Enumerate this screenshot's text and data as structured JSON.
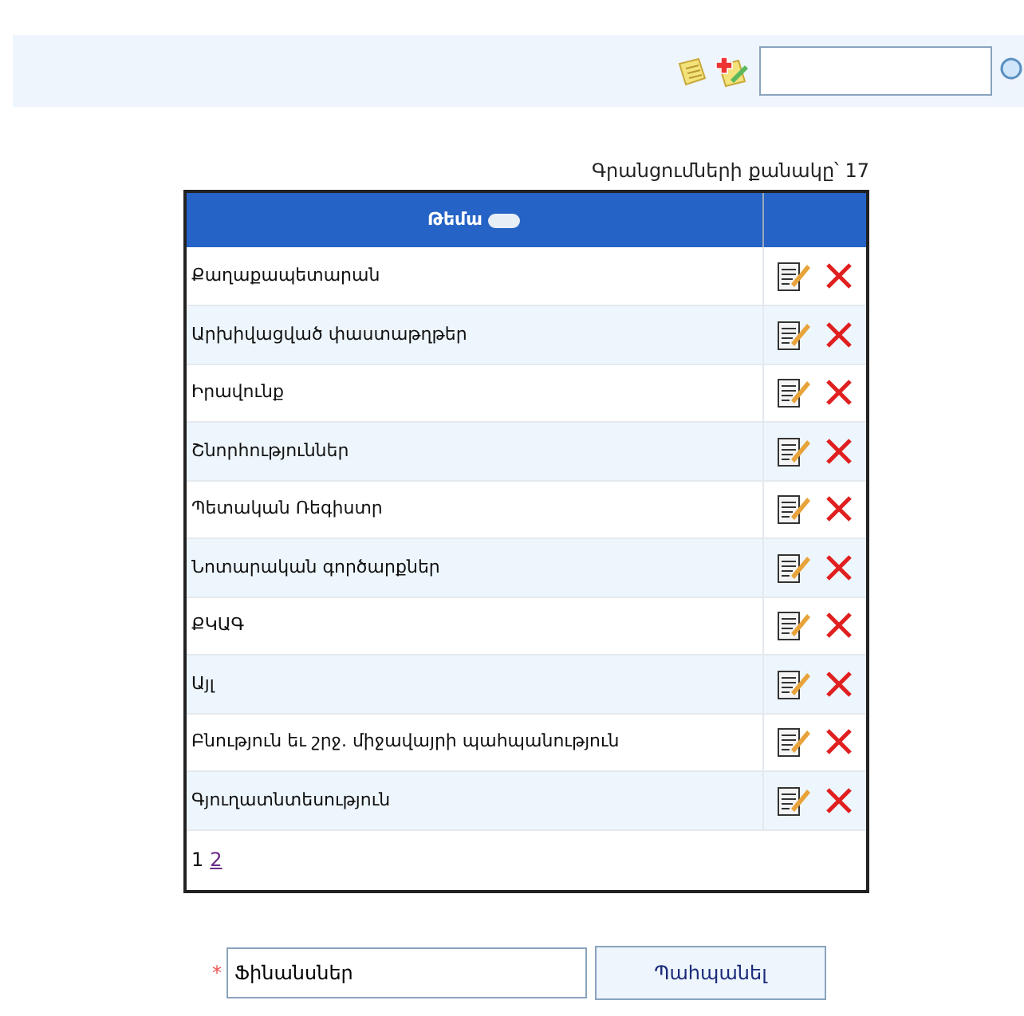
{
  "record_count": "Գրանցումների քանակը՝ 17",
  "table": {
    "columns": [
      "Թեմա"
    ],
    "rows": [
      {
        "topic": "Քաղաքապետարան"
      },
      {
        "topic": "Արխիվացված փաստաթղթեր"
      },
      {
        "topic": "Իրավունք"
      },
      {
        "topic": "Շնորհություններ"
      },
      {
        "topic": "Պետական Ռեգիստր"
      },
      {
        "topic": "Նոտարական գործարքներ"
      },
      {
        "topic": "ՔԿԱԳ"
      },
      {
        "topic": "Այլ"
      },
      {
        "topic": "Բնություն եւ շրջ. միջավայրի պահպանություն"
      },
      {
        "topic": "Գյուղատնտեսություն"
      }
    ],
    "pages": [
      {
        "label": "1",
        "selected": true
      },
      {
        "label": "2",
        "selected": false
      }
    ]
  },
  "form": {
    "required_mark": "*",
    "value": "Ֆինանսներ",
    "button": "Պահպանել"
  }
}
